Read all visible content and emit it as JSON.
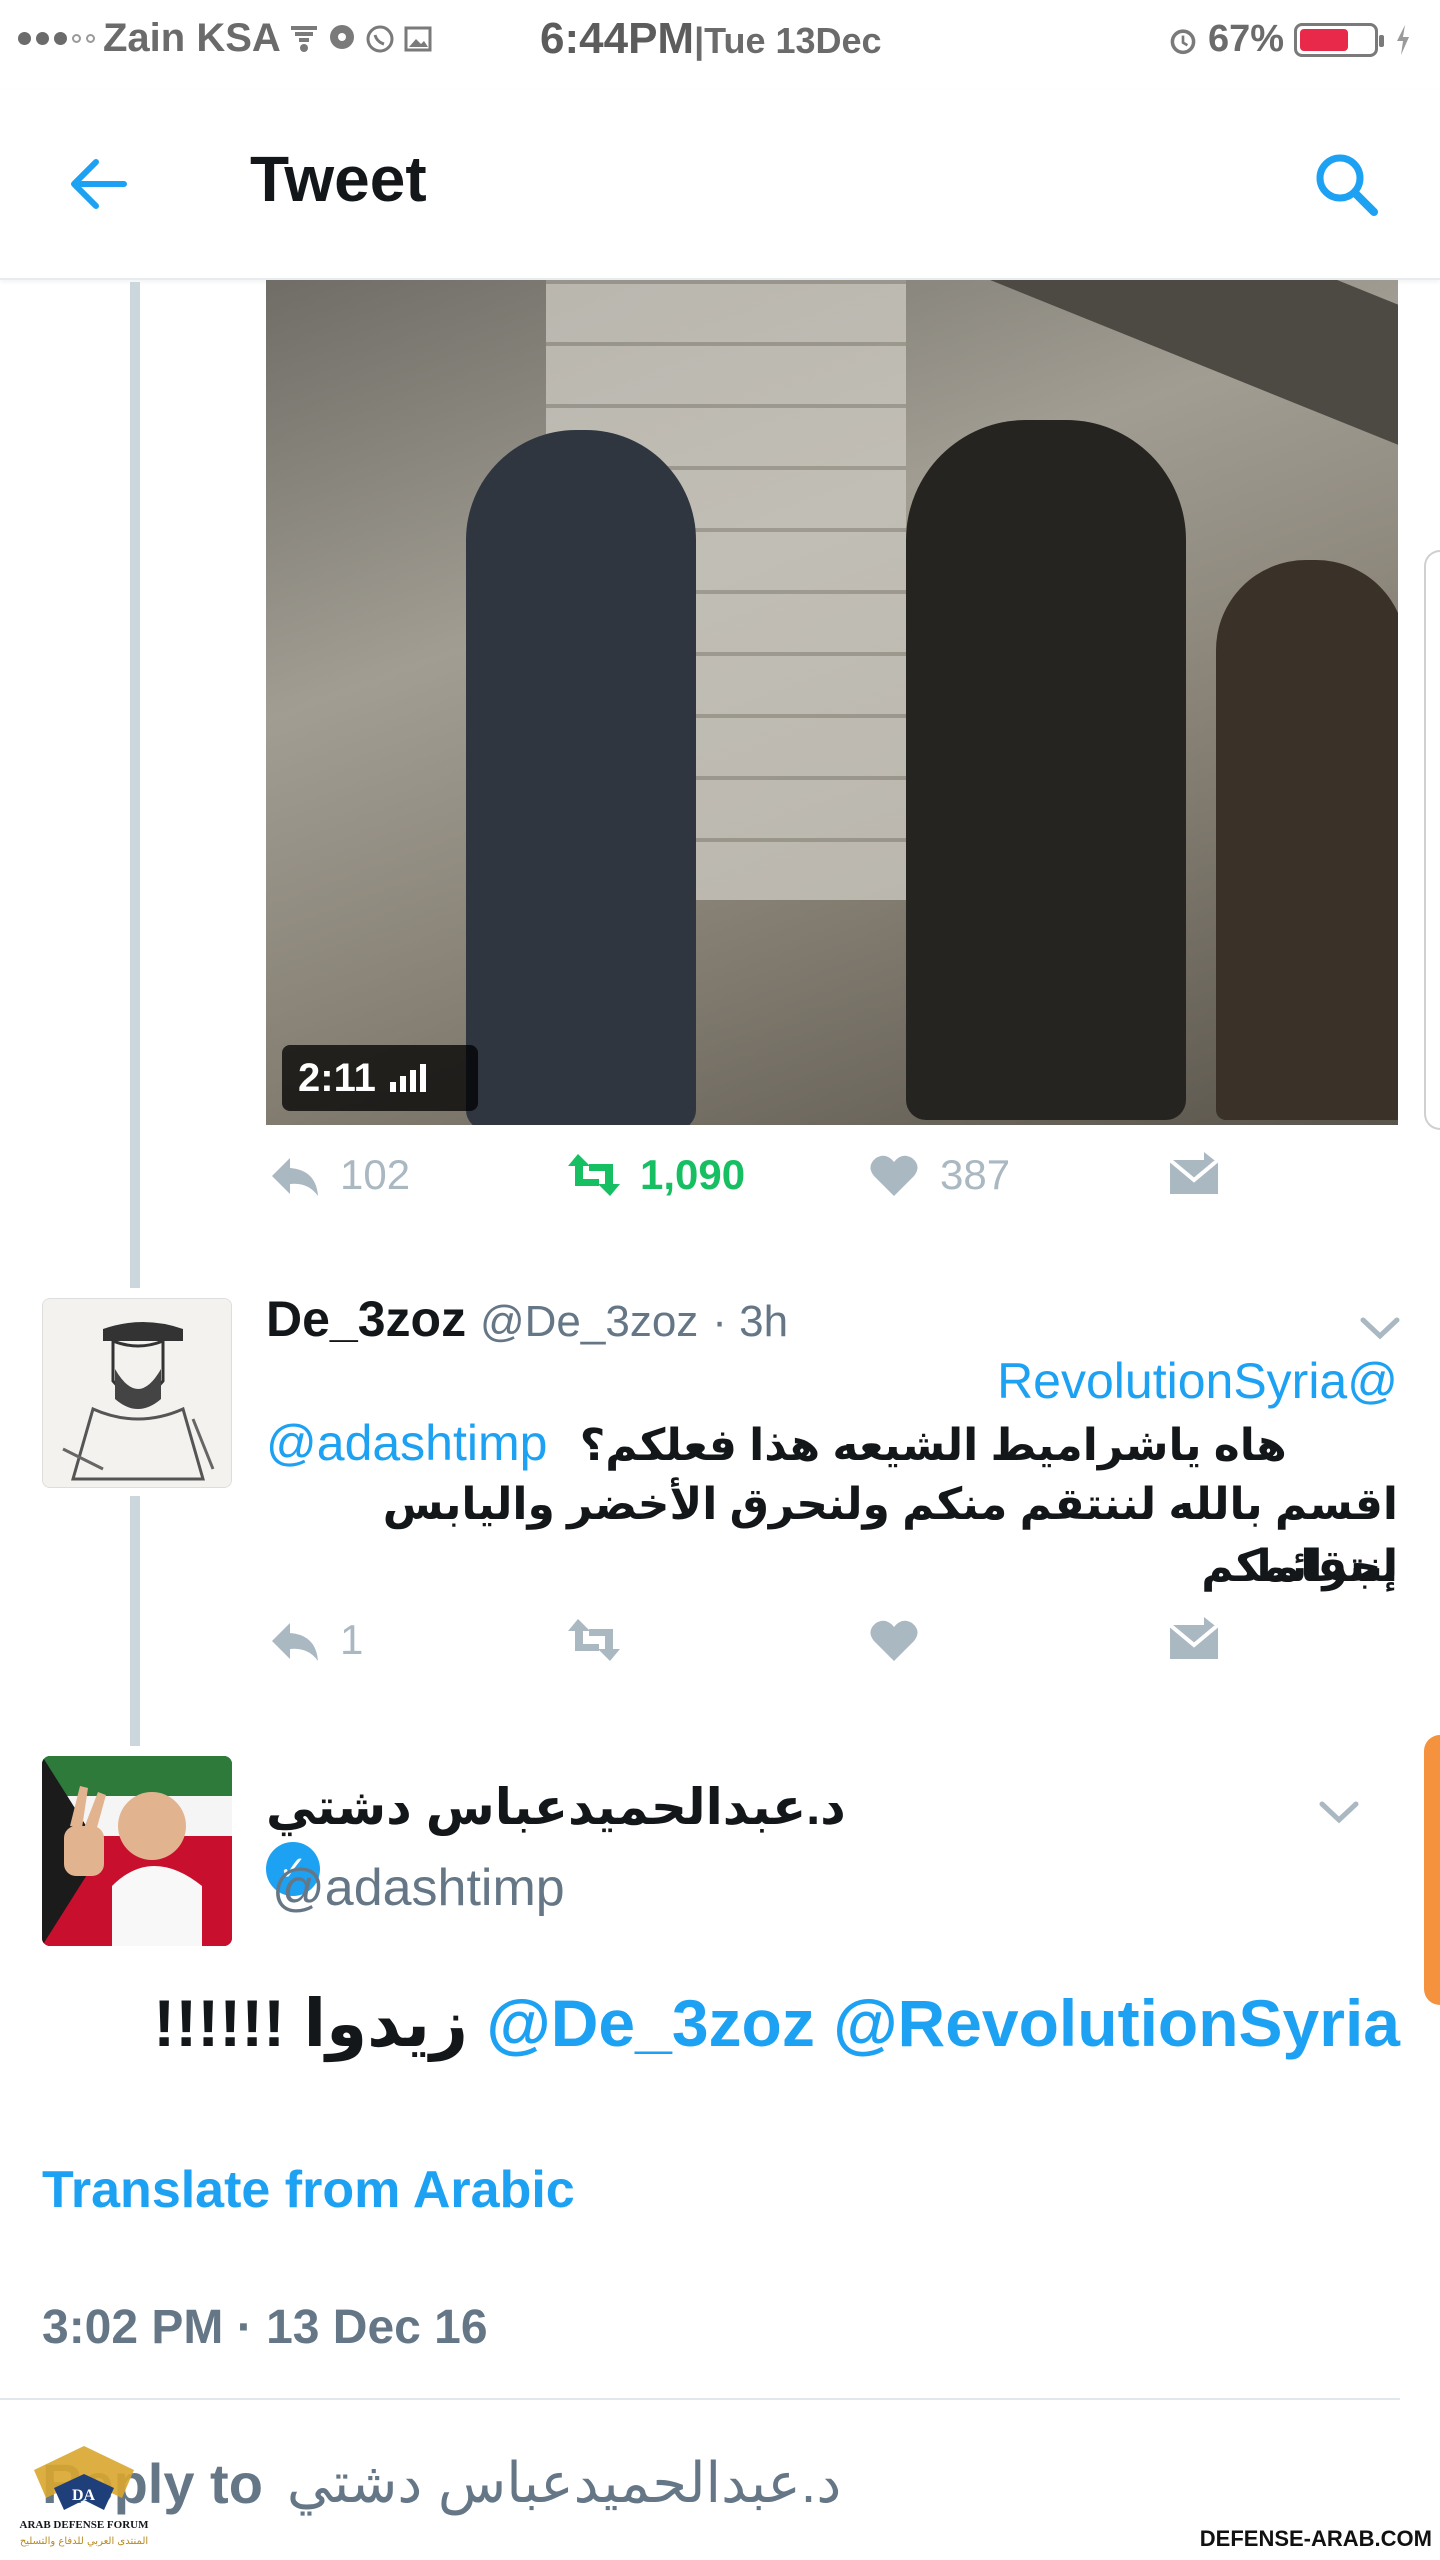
{
  "status_bar": {
    "carrier": "Zain KSA",
    "time": "6:44PM",
    "date": "Tue 13Dec",
    "battery_percent": "67%",
    "battery_level": 0.67,
    "icons": [
      "signal-dots",
      "wifi-icon",
      "location-icon",
      "whatsapp-icon",
      "gallery-icon",
      "alarm-icon",
      "battery-icon",
      "charging-icon"
    ]
  },
  "header": {
    "title": "Tweet",
    "back_icon": "arrow-left-icon",
    "search_icon": "search-icon",
    "accent_color": "#1da1f2"
  },
  "video": {
    "duration": "2:11"
  },
  "tweet_actions_top": {
    "replies": "102",
    "retweets": "1,090",
    "likes": "387"
  },
  "reply_tweet": {
    "name": "De_3zoz",
    "handle": "@De_3zoz",
    "age": "· 3h",
    "mention_1": "@RevolutionSyria",
    "mention_2": "@adashtimp",
    "line_1": "هاه ياشراميط الشيعه هذا فعلكم؟",
    "line_2": "اقسم بالله لننتقم منكم ولنحرق الأخضر واليابس إنتقاما",
    "line_3": "لجرائمكم",
    "replies": "1"
  },
  "main_tweet": {
    "name": "د.عبدالحميدعباس دشتي",
    "handle": "@adashtimp",
    "verified": true,
    "mention_1": "@RevolutionSyria",
    "mention_2": "@De_3zoz",
    "body": "زيدوا !!!!!!",
    "translate_label": "Translate from Arabic",
    "timestamp": "3:02 PM · 13 Dec 16"
  },
  "reply_bar": {
    "label": "Reply to",
    "name": "د.عبدالحميدعباس دشتي"
  },
  "watermark": {
    "site": "DEFENSE-ARAB.COM",
    "logo_text_en": "ARAB DEFENSE FORUM",
    "logo_text_ar": "المنتدى العربي للدفاع والتسليح"
  }
}
